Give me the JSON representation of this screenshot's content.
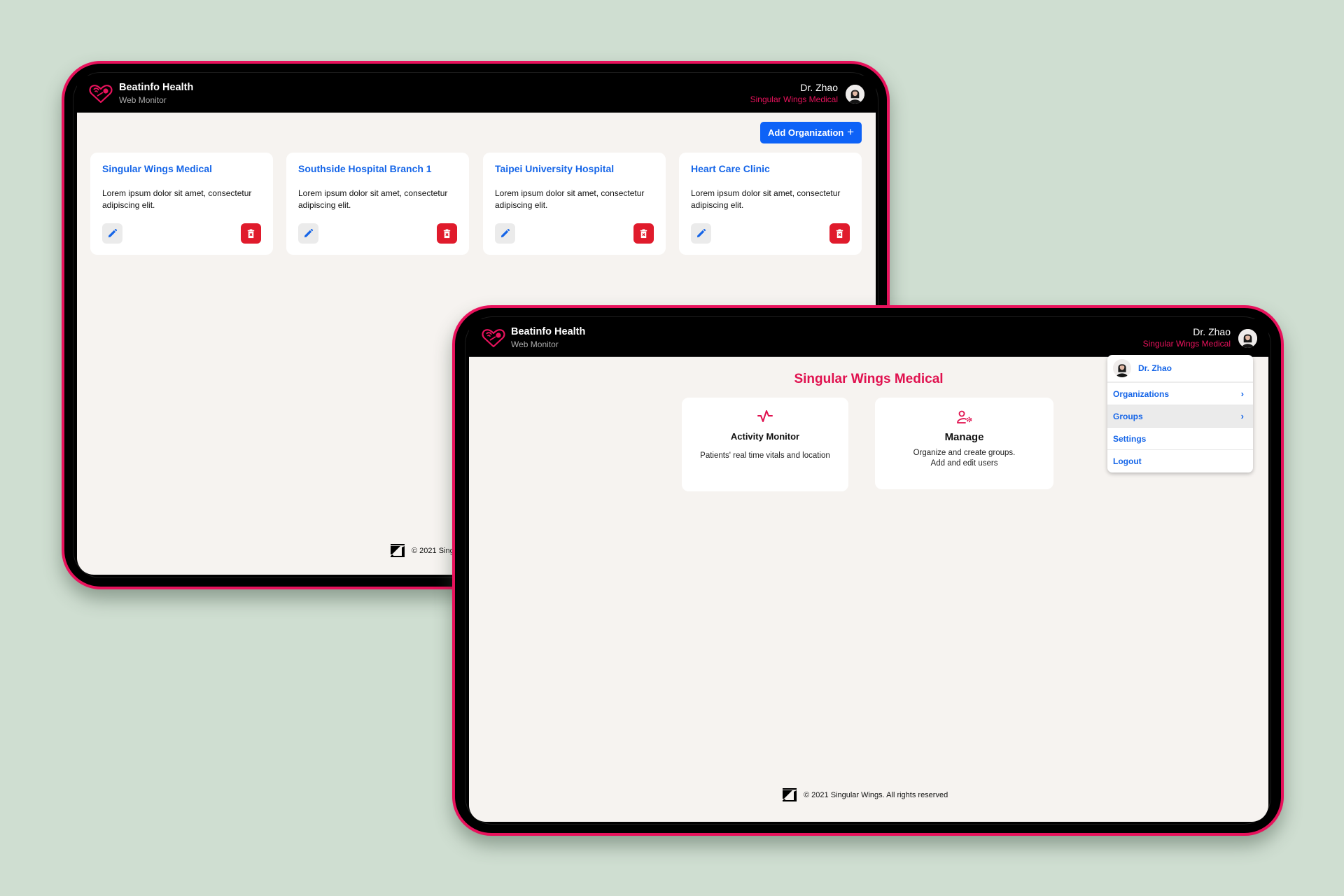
{
  "colors": {
    "background": "#cfded1",
    "brand_pink": "#e8125c",
    "link_blue": "#1565e8",
    "primary_button": "#0d62f7",
    "danger": "#e01b2c",
    "screen_bg": "#f6f3f0"
  },
  "app": {
    "title": "Beatinfo Health",
    "subtitle": "Web Monitor",
    "logo_icon": "heart-pill-icon"
  },
  "user": {
    "name": "Dr. Zhao",
    "organization": "Singular Wings Medical",
    "avatar_icon": "user-avatar"
  },
  "organizations_screen": {
    "add_button_label": "Add Organization",
    "add_button_icon": "+",
    "cards": [
      {
        "title": "Singular Wings Medical",
        "description": "Lorem ipsum dolor sit amet, consectetur adipiscing elit.",
        "edit_icon": "pencil-icon",
        "delete_icon": "trash-icon"
      },
      {
        "title": "Southside Hospital Branch 1",
        "description": "Lorem ipsum dolor sit amet, consectetur adipiscing elit.",
        "edit_icon": "pencil-icon",
        "delete_icon": "trash-icon"
      },
      {
        "title": "Taipei University Hospital",
        "description": "Lorem ipsum dolor sit amet, consectetur adipiscing elit.",
        "edit_icon": "pencil-icon",
        "delete_icon": "trash-icon"
      },
      {
        "title": "Heart Care Clinic",
        "description": "Lorem ipsum dolor sit amet, consectetur adipiscing elit.",
        "edit_icon": "pencil-icon",
        "delete_icon": "trash-icon"
      }
    ],
    "footer_text": "© 2021 Sing"
  },
  "home_screen": {
    "org_title": "Singular Wings Medical",
    "features": [
      {
        "title": "Activity Monitor",
        "description": "Patients' real time vitals and location",
        "icon": "pulse-icon"
      },
      {
        "title": "Manage",
        "description_line1": "Organize and create groups.",
        "description_line2": "Add and edit users",
        "icon": "user-settings-icon"
      }
    ],
    "user_menu": {
      "header_name": "Dr. Zhao",
      "items": [
        {
          "label": "Organizations",
          "has_submenu": true,
          "chevron": "›"
        },
        {
          "label": "Groups",
          "has_submenu": true,
          "chevron": "›",
          "highlighted": true
        },
        {
          "label": "Settings",
          "has_submenu": false
        },
        {
          "label": "Logout",
          "has_submenu": false
        }
      ]
    },
    "footer_text": "© 2021 Singular Wings. All rights reserved"
  }
}
